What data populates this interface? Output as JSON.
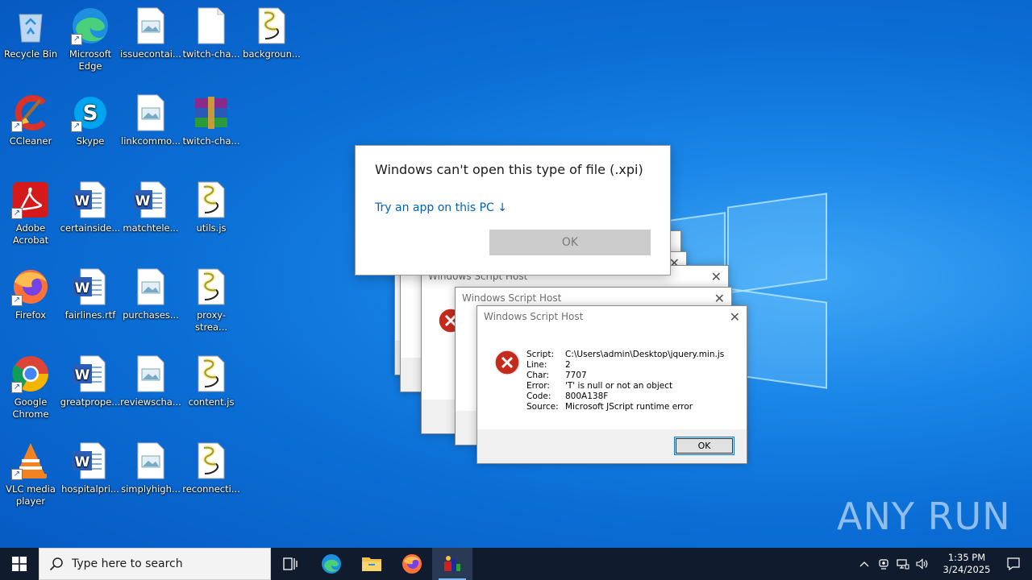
{
  "desktop": {
    "icons": [
      {
        "label": "Recycle Bin",
        "icon": "recycle-bin-icon"
      },
      {
        "label": "Microsoft Edge",
        "icon": "edge-icon"
      },
      {
        "label": "issuecontai...",
        "icon": "image-file-icon"
      },
      {
        "label": "twitch-cha...",
        "icon": "blank-file-icon"
      },
      {
        "label": "backgroun...",
        "icon": "script-file-icon"
      },
      {
        "label": "CCleaner",
        "icon": "ccleaner-icon"
      },
      {
        "label": "Skype",
        "icon": "skype-icon"
      },
      {
        "label": "linkcommo...",
        "icon": "image-file-icon"
      },
      {
        "label": "twitch-cha...",
        "icon": "winrar-icon"
      },
      {
        "label": "Adobe Acrobat",
        "icon": "acrobat-icon"
      },
      {
        "label": "certainside...",
        "icon": "word-file-icon"
      },
      {
        "label": "matchtele...",
        "icon": "word-file-icon"
      },
      {
        "label": "utils.js",
        "icon": "script-file-icon"
      },
      {
        "label": "Firefox",
        "icon": "firefox-icon"
      },
      {
        "label": "fairlines.rtf",
        "icon": "word-file-icon"
      },
      {
        "label": "purchases...",
        "icon": "image-file-icon"
      },
      {
        "label": "proxy-strea...",
        "icon": "script-file-icon"
      },
      {
        "label": "Google Chrome",
        "icon": "chrome-icon"
      },
      {
        "label": "greatprope...",
        "icon": "word-file-icon"
      },
      {
        "label": "reviewscha...",
        "icon": "image-file-icon"
      },
      {
        "label": "content.js",
        "icon": "script-file-icon"
      },
      {
        "label": "VLC media player",
        "icon": "vlc-icon"
      },
      {
        "label": "hospitalpri...",
        "icon": "word-file-icon"
      },
      {
        "label": "simplyhigh...",
        "icon": "image-file-icon"
      },
      {
        "label": "reconnecti...",
        "icon": "script-file-icon"
      }
    ]
  },
  "open_dialog": {
    "title": "Windows can't open this type of file (.xpi)",
    "link": "Try an app on this PC ↓",
    "ok": "OK"
  },
  "wsh_dialog": {
    "title": "Windows Script Host",
    "rows": [
      {
        "key": "Script:",
        "value": "C:\\Users\\admin\\Desktop\\jquery.min.js"
      },
      {
        "key": "Line:",
        "value": "2"
      },
      {
        "key": "Char:",
        "value": "7707"
      },
      {
        "key": "Error:",
        "value": "'T' is null or not an object"
      },
      {
        "key": "Code:",
        "value": "800A138F"
      },
      {
        "key": "Source:",
        "value": "Microsoft JScript runtime error"
      }
    ],
    "ok": "OK"
  },
  "taskbar": {
    "search_placeholder": "Type here to search",
    "time": "1:35 PM",
    "date": "3/24/2025"
  },
  "watermark": "ANY RUN",
  "colors": {
    "accent": "#0078d7",
    "taskbar": "#101b2d",
    "link": "#0063b1"
  }
}
